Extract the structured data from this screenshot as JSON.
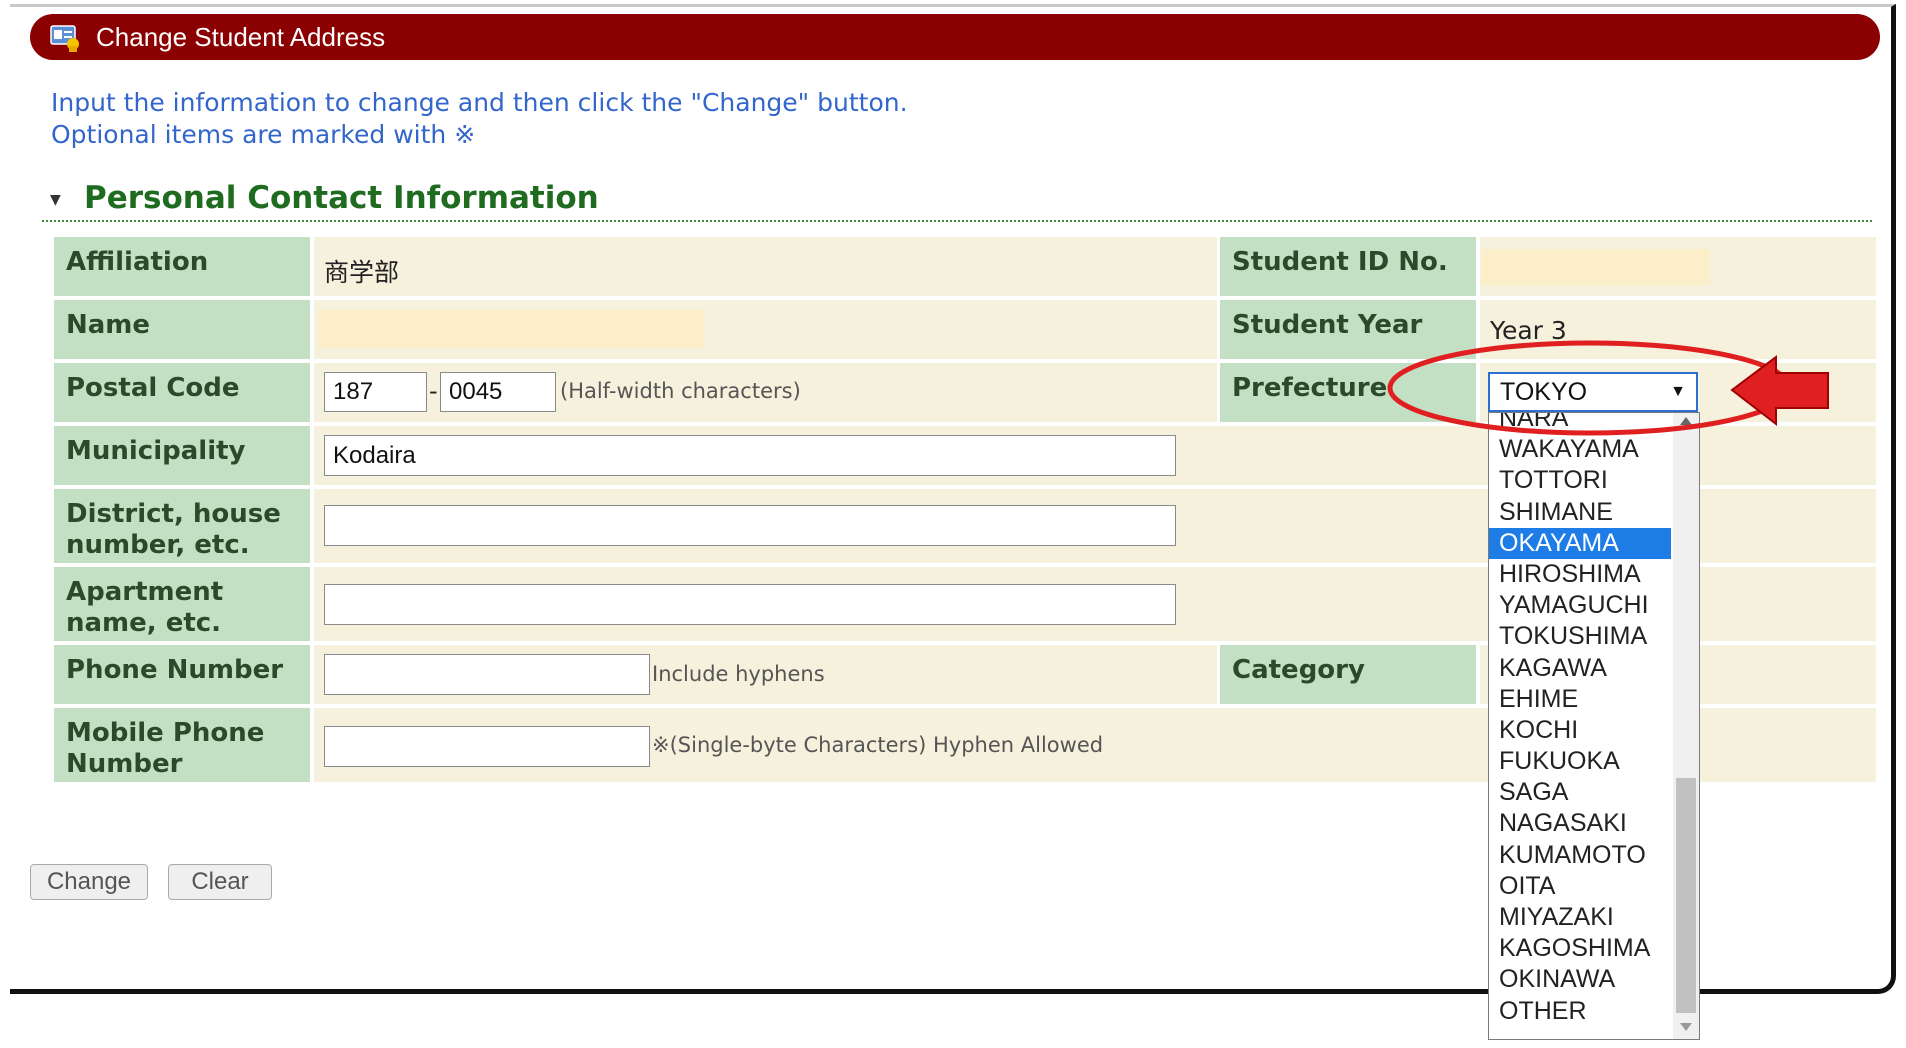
{
  "title": "Change Student Address",
  "intro": {
    "line1": "Input the information to change and then click the \"Change\" button.",
    "line2": "Optional items are marked with ※"
  },
  "section": {
    "title": "Personal Contact Information"
  },
  "fields": {
    "affiliation": {
      "label": "Affiliation",
      "value": "商学部"
    },
    "student_id": {
      "label": "Student ID No.",
      "value": ""
    },
    "name": {
      "label": "Name",
      "value": ""
    },
    "student_year": {
      "label": "Student Year",
      "value": "Year 3"
    },
    "postal_code": {
      "label": "Postal Code",
      "part1": "187",
      "sep": "-",
      "part2": "0045",
      "hint": "(Half-width characters)"
    },
    "prefecture": {
      "label": "Prefecture",
      "selected": "TOKYO",
      "arrow": "▼"
    },
    "municipality": {
      "label": "Municipality",
      "value": "Kodaira"
    },
    "district": {
      "label": "District, house number, etc.",
      "value": ""
    },
    "apartment": {
      "label": "Apartment name, etc.",
      "value": ""
    },
    "phone": {
      "label": "Phone Number",
      "value": "",
      "hint": "Include hyphens"
    },
    "category": {
      "label": "Category"
    },
    "mobile": {
      "label": "Mobile Phone Number",
      "value": "",
      "hint": "※(Single-byte Characters) Hyphen Allowed"
    }
  },
  "prefecture_options": [
    "NARA",
    "WAKAYAMA",
    "TOTTORI",
    "SHIMANE",
    "OKAYAMA",
    "HIROSHIMA",
    "YAMAGUCHI",
    "TOKUSHIMA",
    "KAGAWA",
    "EHIME",
    "KOCHI",
    "FUKUOKA",
    "SAGA",
    "NAGASAKI",
    "KUMAMOTO",
    "OITA",
    "MIYAZAKI",
    "KAGOSHIMA",
    "OKINAWA",
    "OTHER"
  ],
  "highlighted_option": "OKAYAMA",
  "buttons": {
    "change": "Change",
    "clear": "Clear"
  },
  "colors": {
    "header": "#8b0000",
    "label_bg": "#c4e0c4",
    "value_bg": "#f6f1dd",
    "annotation": "#e02020",
    "intro_text": "#3366cc",
    "section_text": "#1f6b1f"
  },
  "icons": {
    "title_icon": "user-card-icon",
    "annotation_arrow": "red-arrow-icon"
  }
}
